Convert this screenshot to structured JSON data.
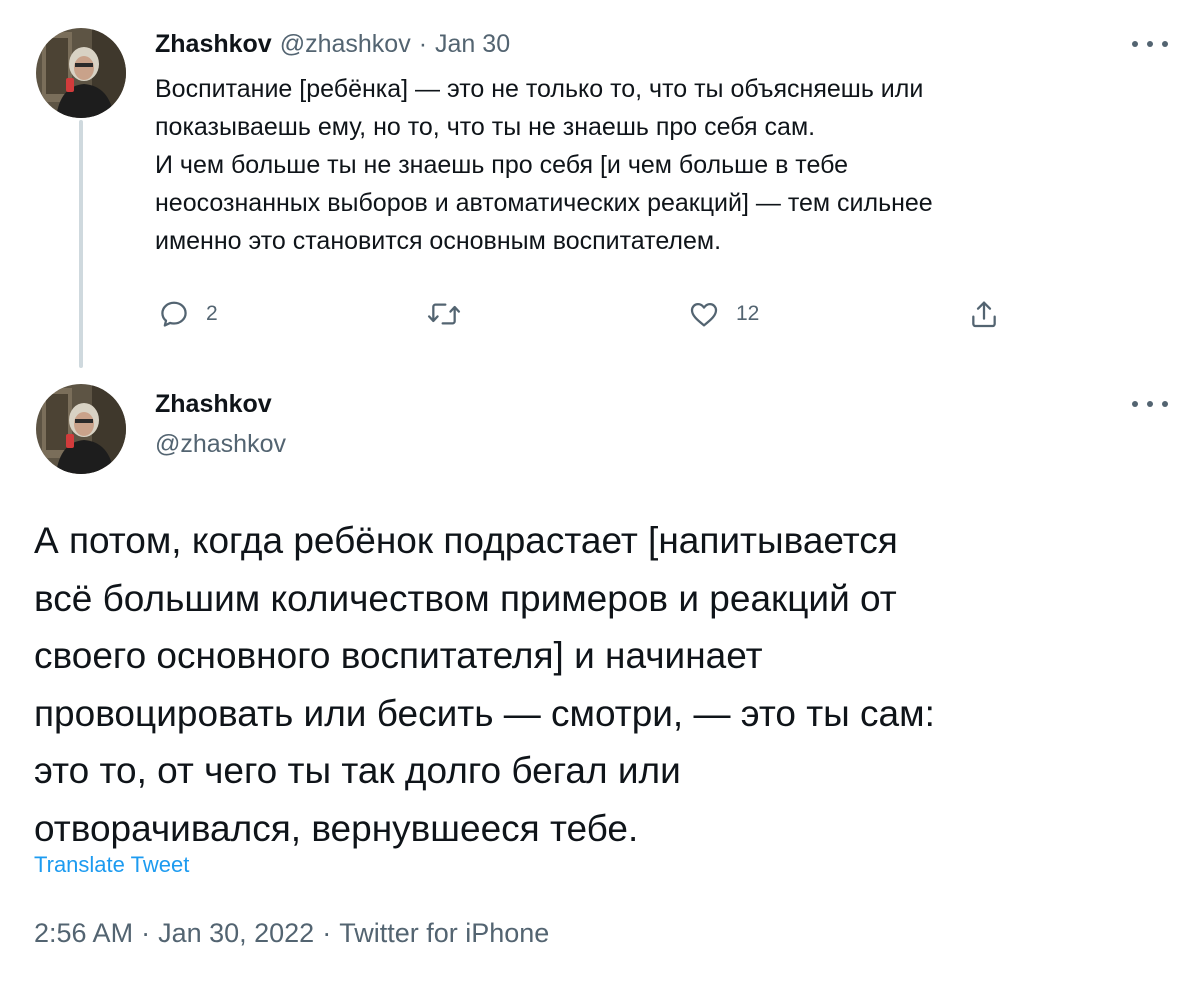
{
  "colors": {
    "text": "#0f1419",
    "muted": "#536471",
    "link": "#1d9bf0",
    "thread_line": "#cfd9de"
  },
  "parent_tweet": {
    "display_name": "Zhashkov",
    "handle": "@zhashkov",
    "separator": "·",
    "date": "Jan 30",
    "text_lines": [
      "Воспитание [ребёнка] — это не только то, что ты объясняешь или",
      "показываешь ему, но то, что ты не знаешь про себя сам.",
      "И чем больше ты не знаешь про себя [и чем больше в тебе",
      "неосознанных выборов и автоматических реакций] — тем сильнее",
      "именно это становится основным воспитателем."
    ],
    "actions": {
      "reply_icon": "reply-icon",
      "reply_count": "2",
      "retweet_icon": "retweet-icon",
      "like_icon": "heart-icon",
      "like_count": "12",
      "share_icon": "share-icon"
    },
    "more_icon": "more-options-icon"
  },
  "main_tweet": {
    "display_name": "Zhashkov",
    "handle": "@zhashkov",
    "text_lines": [
      "А потом, когда ребёнок подрастает [напитывается",
      "всё большим количеством примеров и реакций от",
      "своего основного воспитателя] и начинает",
      "провоцировать или бесить — смотри, — это ты сам:",
      "это то, от чего ты так долго бегал или",
      "отворачивался, вернувшееся тебе."
    ],
    "translate_label": "Translate Tweet",
    "time": "2:56 AM",
    "date": "Jan 30, 2022",
    "source": "Twitter for iPhone",
    "separator": "·",
    "more_icon": "more-options-icon"
  }
}
